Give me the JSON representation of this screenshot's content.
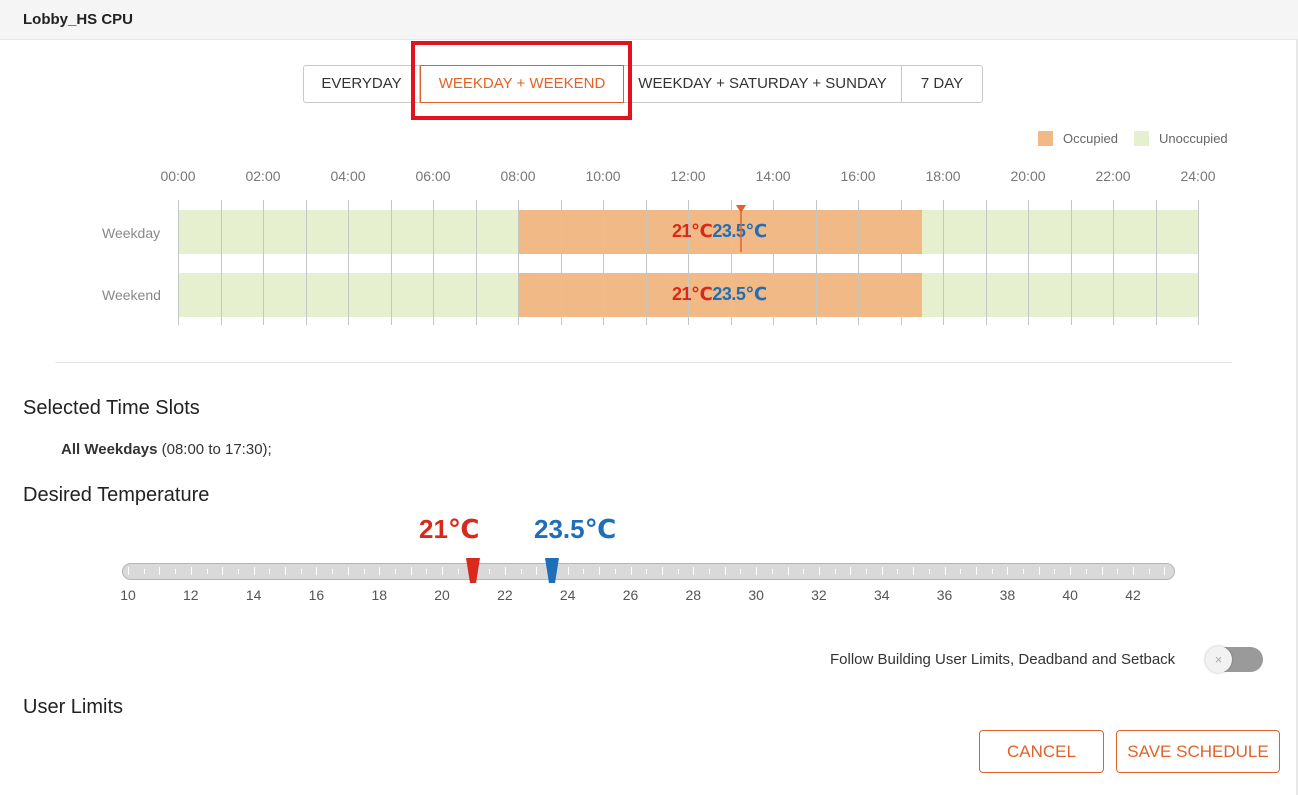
{
  "window": {
    "title": "Lobby_HS CPU"
  },
  "mode_tabs": [
    {
      "label": "EVERYDAY",
      "active": false
    },
    {
      "label": "WEEKDAY + WEEKEND",
      "active": true
    },
    {
      "label": "WEEKDAY + SATURDAY + SUNDAY",
      "active": false
    },
    {
      "label": "7 DAY",
      "active": false
    }
  ],
  "legend": {
    "occupied": "Occupied",
    "unoccupied": "Unoccupied",
    "occupied_color": "#f0b985",
    "unoccupied_color": "#e6f0cf"
  },
  "schedule": {
    "hour_labels": [
      "00:00",
      "02:00",
      "04:00",
      "06:00",
      "08:00",
      "10:00",
      "12:00",
      "14:00",
      "16:00",
      "18:00",
      "20:00",
      "22:00",
      "24:00"
    ],
    "rows": [
      {
        "label": "Weekday",
        "occupied_start": "08:00",
        "occupied_end": "17:30",
        "heat": "21℃",
        "cool": "23.5℃"
      },
      {
        "label": "Weekend",
        "occupied_start": "08:00",
        "occupied_end": "17:30",
        "heat": "21℃",
        "cool": "23.5℃"
      }
    ],
    "current_time": "13:15"
  },
  "selected_slots": {
    "title": "Selected Time Slots",
    "day_label": "All Weekdays",
    "range": " (08:00 to 17:30);"
  },
  "desired_temperature": {
    "title": "Desired Temperature",
    "heat_label": "21℃",
    "cool_label": "23.5℃",
    "heat_value": 21,
    "cool_value": 23.5,
    "scale_min": 10,
    "scale_max": 43,
    "scale_labels": [
      "10",
      "12",
      "14",
      "16",
      "18",
      "20",
      "22",
      "24",
      "26",
      "28",
      "30",
      "32",
      "34",
      "36",
      "38",
      "40",
      "42"
    ],
    "heat_color": "#d9291c",
    "cool_color": "#1e6fb8"
  },
  "follow_limits": {
    "label": "Follow Building User Limits, Deadband and Setback",
    "enabled": false,
    "knob_glyph": "×"
  },
  "user_limits": {
    "title": "User Limits"
  },
  "buttons": {
    "cancel": "CANCEL",
    "save": "SAVE SCHEDULE"
  },
  "accent_color": "#e0622a"
}
